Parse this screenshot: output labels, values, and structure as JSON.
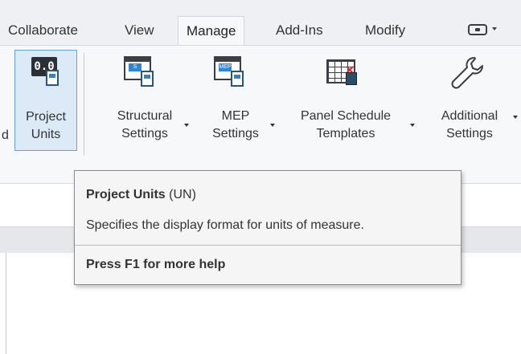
{
  "tabs": [
    {
      "label": "Collaborate",
      "active": false
    },
    {
      "label": "View",
      "active": false
    },
    {
      "label": "Manage",
      "active": true
    },
    {
      "label": "Add-Ins",
      "active": false
    },
    {
      "label": "Modify",
      "active": false
    }
  ],
  "quick_access": {
    "icon": "quick-access-toolbar-icon",
    "dropdown": "chevron-down-icon"
  },
  "ribbon": {
    "cut_off_letter": "d",
    "buttons": [
      {
        "line1": "Project",
        "line2": "Units",
        "icon": "project-units-icon",
        "icon_text": "0.0",
        "active": true
      },
      {
        "line1": "Structural",
        "line2": "Settings",
        "icon": "structural-settings-icon",
        "icon_text": "S"
      },
      {
        "line1": "MEP",
        "line2": "Settings",
        "icon": "mep-settings-icon",
        "icon_text": "MEP"
      },
      {
        "line1": "Panel Schedule",
        "line2": "Templates",
        "icon": "panel-schedule-templates-icon"
      },
      {
        "line1": "Additional",
        "line2": "Settings",
        "icon": "wrench-icon"
      }
    ]
  },
  "tooltip": {
    "title": "Project Units",
    "shortcut": "(UN)",
    "description": "Specifies the display format for units of measure.",
    "help": "Press F1 for more help"
  },
  "colors": {
    "ribbon_bg": "#f7f8fa",
    "active_button_bg": "#dce9f7",
    "active_button_border": "#6aa2d6",
    "tooltip_bg": "#f5f5f6",
    "accent_blue": "#2e86d9"
  }
}
